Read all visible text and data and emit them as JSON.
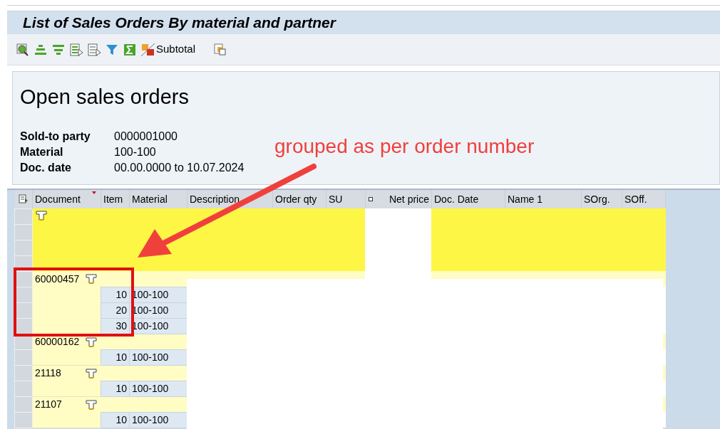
{
  "window": {
    "title": "List of Sales Orders By material and partner"
  },
  "toolbar": {
    "subtotal_label": "Subtotal"
  },
  "header": {
    "title": "Open sales orders",
    "fields": [
      {
        "label": "Sold-to party",
        "value": "0000001000"
      },
      {
        "label": "Material",
        "value": "100-100"
      },
      {
        "label": "Doc. date",
        "value": "00.00.0000 to 10.07.2024"
      }
    ]
  },
  "table": {
    "columns": [
      {
        "label": "Document",
        "sorted": true,
        "totaled": false
      },
      {
        "label": "Item",
        "sorted": false,
        "totaled": false
      },
      {
        "label": "Material",
        "sorted": false,
        "totaled": false
      },
      {
        "label": "Description",
        "sorted": false,
        "totaled": false
      },
      {
        "label": "Order qty",
        "sorted": false,
        "totaled": false
      },
      {
        "label": "SU",
        "sorted": false,
        "totaled": false
      },
      {
        "label": "Net price",
        "sorted": false,
        "totaled": true
      },
      {
        "label": "Doc. Date",
        "sorted": false,
        "totaled": false
      },
      {
        "label": "Name 1",
        "sorted": false,
        "totaled": false
      },
      {
        "label": "SOrg.",
        "sorted": false,
        "totaled": false
      },
      {
        "label": "SOff.",
        "sorted": false,
        "totaled": false
      }
    ],
    "groups": [
      {
        "document": "60000457",
        "items": [
          {
            "item": "10",
            "material": "100-100"
          },
          {
            "item": "20",
            "material": "100-100"
          },
          {
            "item": "30",
            "material": "100-100"
          }
        ]
      },
      {
        "document": "60000162",
        "items": [
          {
            "item": "10",
            "material": "100-100"
          }
        ]
      },
      {
        "document": "21118",
        "items": [
          {
            "item": "10",
            "material": "100-100"
          }
        ]
      },
      {
        "document": "21107",
        "items": [
          {
            "item": "10",
            "material": "100-100"
          }
        ]
      }
    ]
  },
  "annotation": {
    "text": "grouped as per order number"
  }
}
